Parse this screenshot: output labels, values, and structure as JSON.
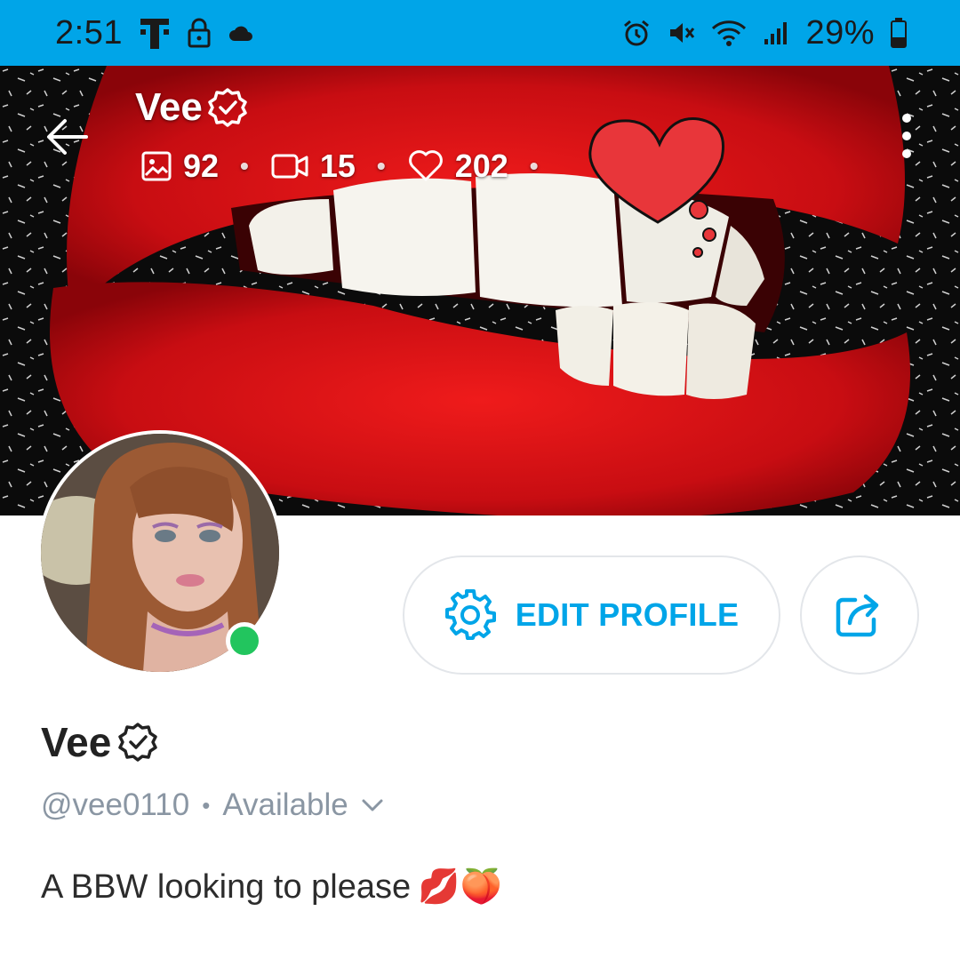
{
  "status_bar": {
    "time": "2:51",
    "battery": "29%",
    "left_icons": [
      "tmobile-icon",
      "lock-icon",
      "cloud-icon"
    ],
    "right_icons": [
      "alarm-icon",
      "mute-icon",
      "wifi-icon",
      "signal-icon",
      "battery-icon"
    ],
    "color": "#00a5e8"
  },
  "header": {
    "title": "Vee",
    "stats": {
      "photos": "92",
      "videos": "15",
      "likes": "202"
    }
  },
  "profile": {
    "name": "Vee",
    "handle": "@vee0110",
    "availability": "Available",
    "bio_text": "A BBW looking to please",
    "bio_emoji": "💋🍑",
    "online": true
  },
  "actions": {
    "edit_label": "EDIT PROFILE"
  },
  "colors": {
    "accent": "#00a5e8",
    "online": "#22c55e",
    "muted": "#8a96a3"
  }
}
